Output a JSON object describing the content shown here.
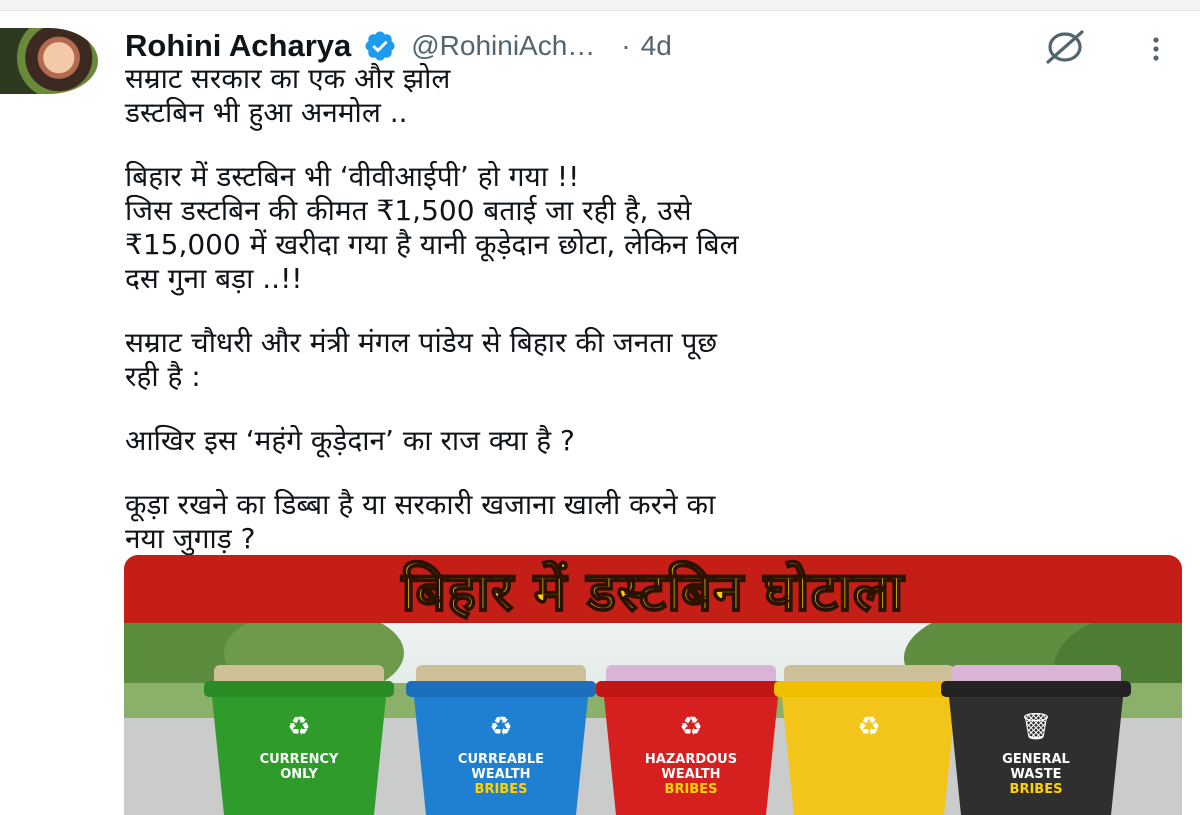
{
  "tweet": {
    "author_name": "Rohini Acharya",
    "handle": "@RohiniAch…",
    "separator": "·",
    "time": "4d",
    "paragraphs": [
      [
        "सम्राट सरकार का एक और झोल",
        "डस्टबिन भी हुआ अनमोल .."
      ],
      [
        "बिहार में डस्टबिन भी ‘वीवीआईपी’ हो गया !!",
        "जिस डस्टबिन की कीमत ₹1,500 बताई जा रही है, उसे",
        "₹15,000 में खरीदा गया है यानी कूड़ेदान छोटा, लेकिन बिल",
        "दस गुना बड़ा ..!!"
      ],
      [
        "सम्राट चौधरी और मंत्री मंगल पांडेय से बिहार की जनता पूछ",
        "रही है :"
      ],
      [
        "आखिर इस ‘महंगे कूड़ेदान’ का राज क्या है ?"
      ],
      [
        "कूड़ा रखने का डिब्बा है या सरकारी खजाना खाली करने का",
        "नया जुगाड़ ?"
      ]
    ]
  },
  "media": {
    "banner_text": "बिहार में डस्टबिन घोटाला",
    "bins": [
      {
        "label_lines": [
          "CURRENCY",
          "ONLY"
        ],
        "color": "#2e9b2a",
        "lid": "#2a8c25"
      },
      {
        "label_lines": [
          "CURREABLE",
          "WEALTH",
          "BRIBES"
        ],
        "color": "#1f7fd1",
        "lid": "#1c6fba"
      },
      {
        "label_lines": [
          "HAZARDOUS",
          "WEALTH",
          "BRIBES"
        ],
        "color": "#d62020",
        "lid": "#c01616"
      },
      {
        "label_lines": [],
        "color": "#f3c51b",
        "lid": "#f0c000"
      },
      {
        "label_lines": [
          "GENERAL",
          "WASTE",
          "BRIBES"
        ],
        "color": "#2f2f30",
        "lid": "#232324"
      }
    ]
  },
  "colors": {
    "verified_blue": "#1d9bf0",
    "secondary_text": "#536471",
    "banner_red": "#c41e17",
    "banner_yellow": "#ffd200"
  },
  "icons": [
    "verified-badge-icon",
    "grok-icon",
    "more-options-icon",
    "recycle-icon",
    "trash-icon"
  ]
}
